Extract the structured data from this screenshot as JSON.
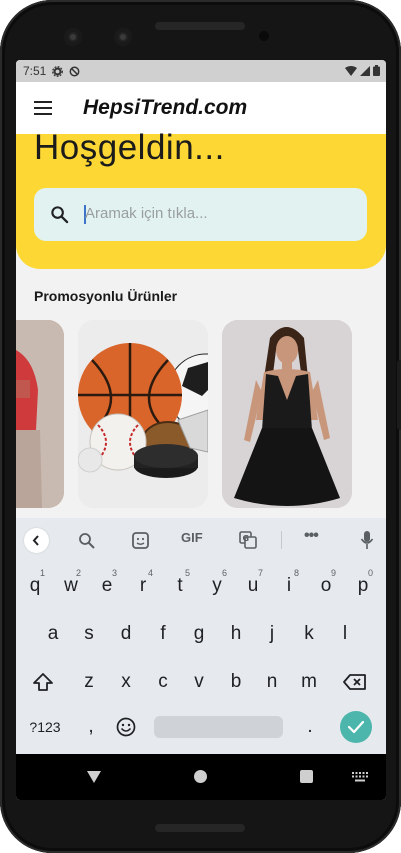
{
  "status_bar": {
    "time": "7:51"
  },
  "app_bar": {
    "title": "HepsiTrend.com"
  },
  "hero": {
    "welcome": "Hoşgeldin...",
    "search_placeholder": "Aramak için tıkla..."
  },
  "promo": {
    "title": "Promosyonlu Ürünler",
    "items": [
      {
        "icon": "person-red-shirt-image"
      },
      {
        "icon": "sports-balls-image"
      },
      {
        "icon": "black-dress-image"
      }
    ]
  },
  "keyboard": {
    "toolbar": {
      "gif_label": "GIF",
      "more_label": "•••"
    },
    "row1": [
      "q",
      "w",
      "e",
      "r",
      "t",
      "y",
      "u",
      "i",
      "o",
      "p"
    ],
    "row1_hints": [
      "1",
      "2",
      "3",
      "4",
      "5",
      "6",
      "7",
      "8",
      "9",
      "0"
    ],
    "row2": [
      "a",
      "s",
      "d",
      "f",
      "g",
      "h",
      "j",
      "k",
      "l"
    ],
    "row3": [
      "z",
      "x",
      "c",
      "v",
      "b",
      "n",
      "m"
    ],
    "symbols_label": "?123",
    "comma_label": ",",
    "period_label": "."
  },
  "colors": {
    "hero_bg": "#fdd835",
    "search_bg": "#e1f2f0",
    "enter_key": "#4db6ac"
  }
}
